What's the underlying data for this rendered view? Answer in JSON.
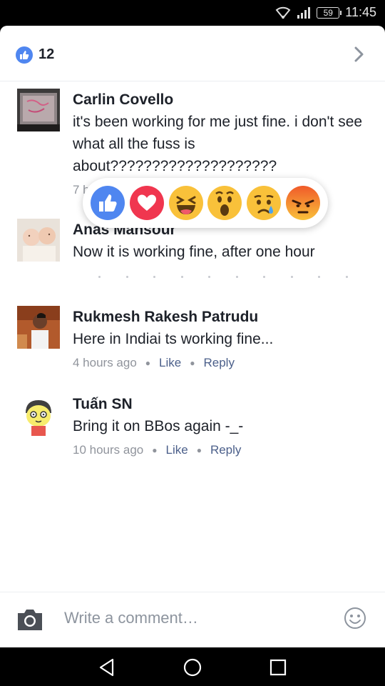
{
  "status_bar": {
    "battery": "59",
    "time": "11:45"
  },
  "header": {
    "like_count": "12"
  },
  "comments": [
    {
      "name": "Carlin Covello",
      "text": "it's been working for me just fine. i don't see what all the fuss is about????????????????????",
      "time_partial": "7 h"
    },
    {
      "name": "Anas Mansour",
      "text": "Now it is working fine, after one hour"
    },
    {
      "name": "Rukmesh Rakesh Patrudu",
      "text": "Here in Indiai ts working fine...",
      "time": "4 hours ago",
      "like": "Like",
      "reply": "Reply"
    },
    {
      "name": "Tuấn SN",
      "text": "Bring it on BBos again -_-",
      "time": "10 hours ago",
      "like": "Like",
      "reply": "Reply"
    }
  ],
  "reactions": [
    "like-icon",
    "love-icon",
    "haha-icon",
    "wow-icon",
    "sad-icon",
    "angry-icon"
  ],
  "composer": {
    "placeholder": "Write a comment…"
  },
  "colors": {
    "accent": "#4f86f0",
    "love": "#f0364f",
    "emoji_yellow": "#f9c13a",
    "angry": "#f05a2a",
    "meta_action": "#4b5f8a"
  }
}
